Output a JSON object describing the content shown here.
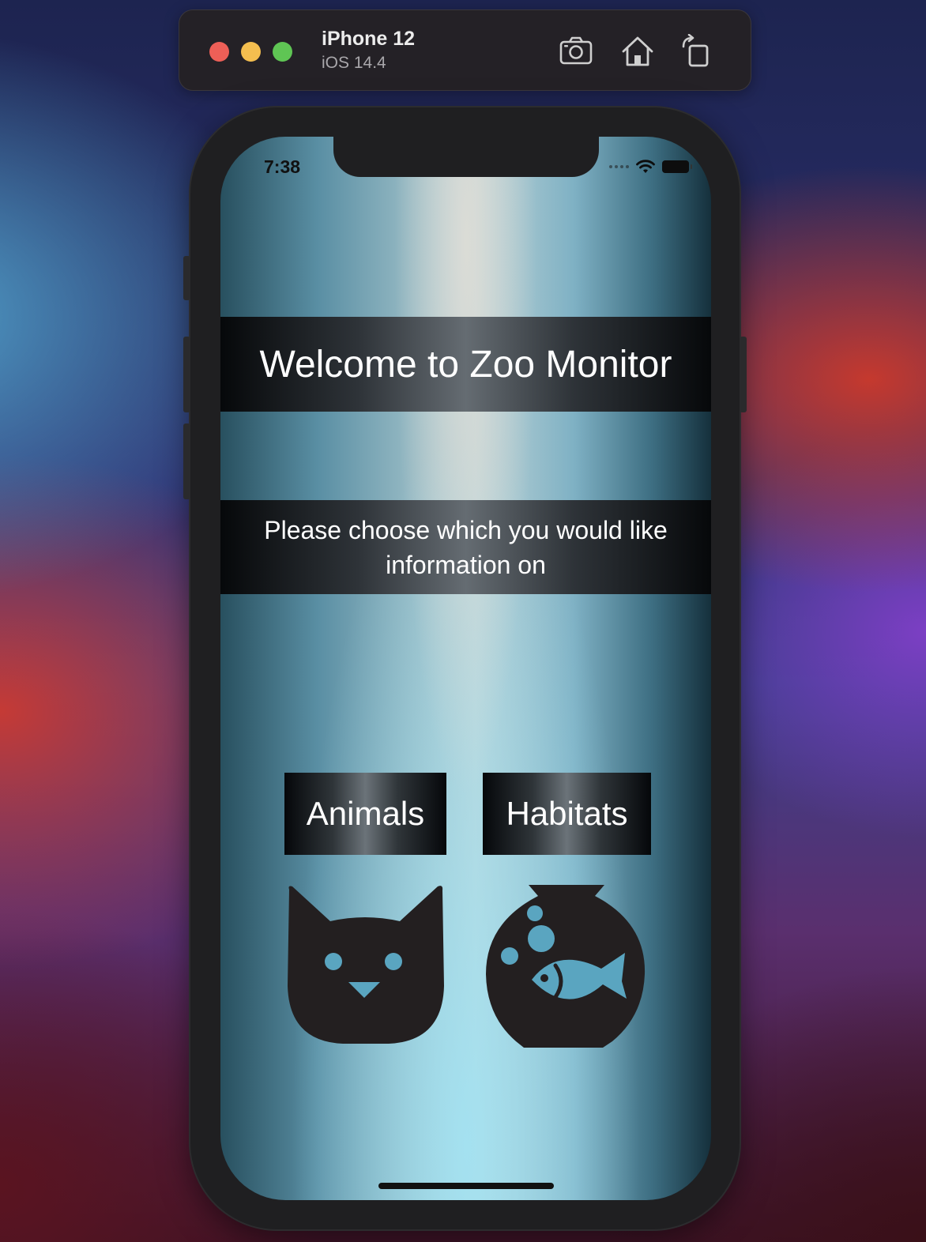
{
  "simulator": {
    "device_name": "iPhone 12",
    "os_version": "iOS 14.4",
    "tools": [
      "screenshot-icon",
      "home-icon",
      "rotate-icon"
    ]
  },
  "status_bar": {
    "time": "7:38"
  },
  "app": {
    "title": "Welcome to Zoo Monitor",
    "subtitle": "Please choose which you would like information on",
    "buttons": {
      "animals": "Animals",
      "habitats": "Habitats"
    },
    "icons": {
      "animals": "cat-face-icon",
      "habitats": "fishbowl-icon"
    }
  },
  "colors": {
    "traffic_red": "#ed5f57",
    "traffic_yellow": "#f4be4f",
    "traffic_green": "#5fc554",
    "icon_dark": "#231f20",
    "icon_accent": "#5aa5c0"
  }
}
